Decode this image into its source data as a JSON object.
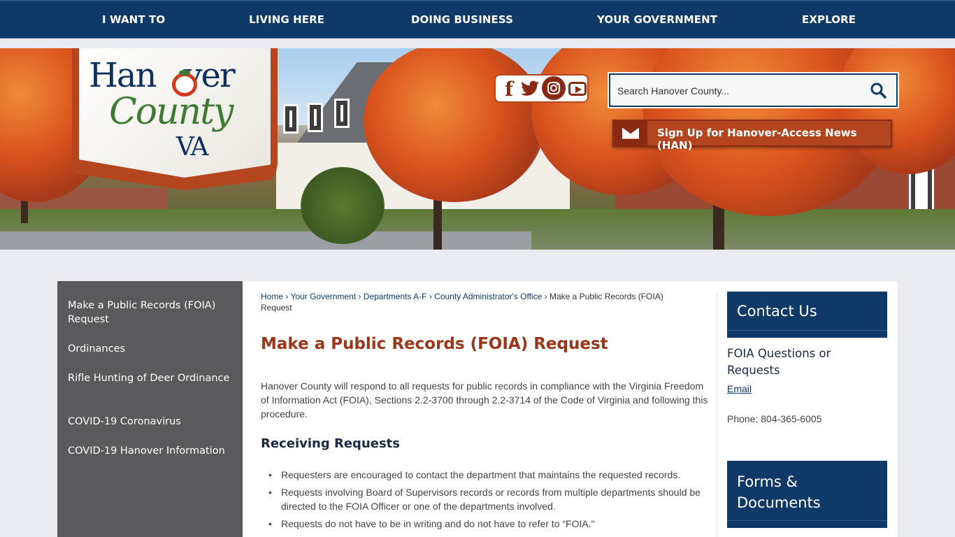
{
  "nav": {
    "items": [
      "I WANT TO",
      "LIVING HERE",
      "DOING BUSINESS",
      "YOUR GOVERNMENT",
      "EXPLORE"
    ]
  },
  "logo": {
    "line1": "Han",
    "line1b": "ver",
    "line2": "County",
    "line3": "VA"
  },
  "social": {
    "icons": [
      "facebook-icon",
      "twitter-icon",
      "instagram-icon",
      "youtube-icon"
    ]
  },
  "search": {
    "placeholder": "Search Hanover County..."
  },
  "han": {
    "label": "Sign Up for Hanover-Access News (HAN)"
  },
  "sidebar": {
    "items": [
      "Make a Public Records (FOIA) Request",
      "Ordinances",
      "Rifle Hunting of Deer Ordinance",
      "COVID-19 Coronavirus",
      "COVID-19 Hanover Information"
    ]
  },
  "breadcrumb": {
    "home": "Home",
    "gov": "Your Government",
    "depts": "Departments A-F",
    "cao": "County Administrator's Office",
    "current": "Make a Public Records (FOIA) Request",
    "sep": "›"
  },
  "main": {
    "title": "Make a Public Records (FOIA) Request",
    "intro": "Hanover County will respond to all requests for public records in compliance with the Virginia Freedom of Information Act (FOIA), Sections 2.2-3700 through 2.2-3714 of the Code of Virginia and following this procedure.",
    "section_heading": "Receiving Requests",
    "bullets": [
      "Requesters are encouraged to contact the department that maintains the requested records.",
      "Requests involving Board of Supervisors records or records from multiple departments should be directed to the FOIA Officer or one of the departments involved.",
      "Requests do not have to be in writing and do not have to refer to “FOIA.”"
    ]
  },
  "contact": {
    "heading": "Contact Us",
    "foia_heading": "FOIA Questions or Requests",
    "email_label": "Email",
    "phone": "Phone: 804-365-6005"
  },
  "forms": {
    "heading": "Forms & Documents"
  },
  "colors": {
    "navy": "#0f3a68",
    "rust": "#b3461f",
    "title": "#9b3618",
    "sidebar": "#5a5a5c"
  }
}
